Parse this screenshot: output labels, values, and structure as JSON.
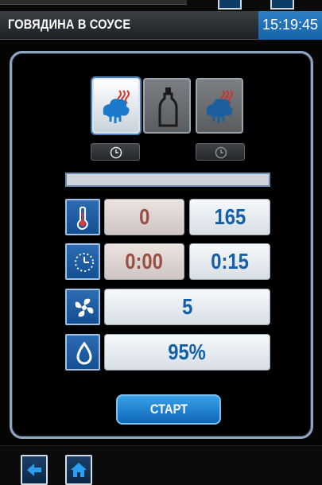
{
  "header": {
    "title": "ГОВЯДИНА В СОУСЕ",
    "time": "15:19:45"
  },
  "modes": [
    {
      "icon": "steam-icon",
      "active": true
    },
    {
      "icon": "bottle-icon",
      "active": false
    },
    {
      "icon": "steam-icon",
      "active": false
    }
  ],
  "timers": [
    {
      "icon": "clock-icon"
    },
    {
      "icon": "clock-icon"
    }
  ],
  "progress": {
    "fraction": 0.0
  },
  "temperature": {
    "icon": "thermometer-icon",
    "current": "0",
    "set": "165"
  },
  "time": {
    "icon": "timer-icon",
    "current": "0:00",
    "set": "0:15"
  },
  "fan": {
    "icon": "fan-icon",
    "value": "5"
  },
  "humidity": {
    "icon": "drop-icon",
    "value": "95%"
  },
  "start_label": "СТАРТ",
  "nav": {
    "back": "arrow-left-icon",
    "home": "home-icon"
  },
  "colors": {
    "accent": "#1763a8",
    "current_text": "#9a4f43",
    "set_text": "#1460a8"
  }
}
